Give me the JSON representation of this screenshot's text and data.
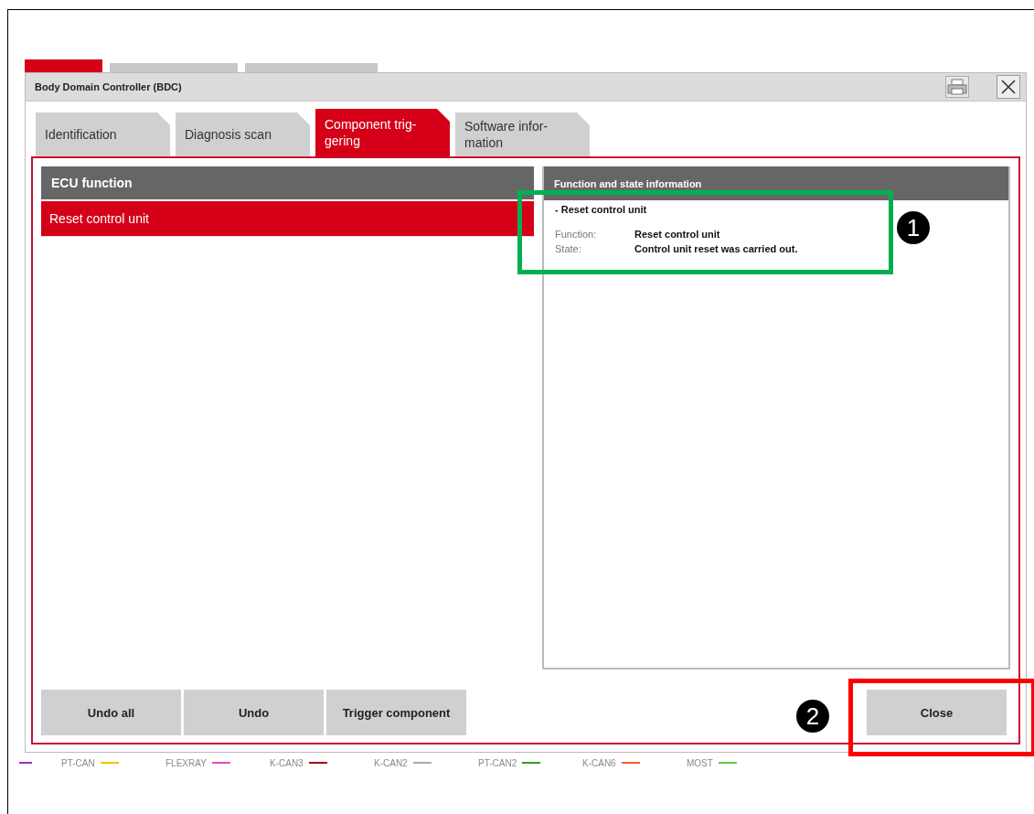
{
  "background_tabs": [
    {
      "selected": true
    },
    {
      "selected": false
    },
    {
      "selected": false
    }
  ],
  "window": {
    "title": "Body Domain Controller (BDC)"
  },
  "tabs": [
    {
      "label": "Identification",
      "selected": false
    },
    {
      "label": "Diagnosis scan",
      "selected": false
    },
    {
      "label": "Component trig-\ngering",
      "selected": true
    },
    {
      "label": "Software infor-\nmation",
      "selected": false
    }
  ],
  "ecu_function": {
    "header": "ECU function",
    "items": [
      {
        "label": "Reset control unit",
        "selected": true
      }
    ]
  },
  "info_panel": {
    "header": "Function and state information",
    "title": "- Reset control unit",
    "rows": [
      {
        "label": "Function:",
        "value": "Reset control unit"
      },
      {
        "label": "State:",
        "value": "Control unit reset was carried out."
      }
    ]
  },
  "buttons": [
    "Undo all",
    "Undo",
    "Trigger component"
  ],
  "close_button": "Close",
  "legend": [
    {
      "color": "#9933cc"
    },
    {
      "label": "PT-CAN",
      "color": "#f2c200"
    },
    {
      "label": "FLEXRAY",
      "color": "#e64dbf"
    },
    {
      "label": "K-CAN3",
      "color": "#a01010"
    },
    {
      "label": "K-CAN2",
      "color": "#aaaaaa"
    },
    {
      "label": "PT-CAN2",
      "color": "#3a9a1a"
    },
    {
      "label": "K-CAN6",
      "color": "#f06030"
    },
    {
      "label": "MOST",
      "color": "#5cd040"
    }
  ],
  "annotations": [
    {
      "label": "1",
      "color": "#00b050"
    },
    {
      "label": "2",
      "color": "#ff0000"
    }
  ]
}
